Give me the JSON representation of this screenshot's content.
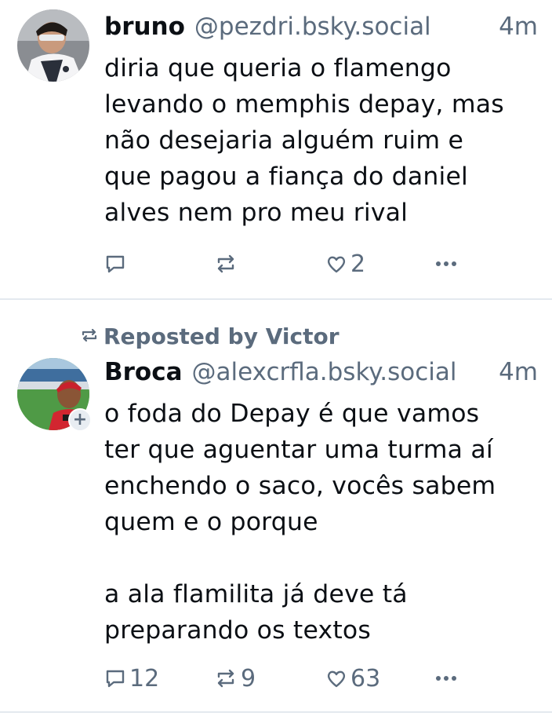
{
  "posts": [
    {
      "author": {
        "display_name": "bruno",
        "handle": "@pezdri.bsky.social"
      },
      "time": "4m",
      "text": "diria que queria o flamengo\nlevando o memphis depay, mas\nnão desejaria alguém ruim e\nque pagou a fiança do daniel\nalves nem pro meu rival",
      "actions": {
        "reply_count": "",
        "repost_count": "",
        "like_count": "2"
      }
    },
    {
      "repost_label": "Reposted by Victor",
      "author": {
        "display_name": "Broca",
        "handle": "@alexcrfla.bsky.social"
      },
      "time": "4m",
      "follow_badge": "+",
      "text": "o foda do Depay é que vamos\nter que aguentar uma turma aí\nenchendo o saco, vocês sabem\nquem e o porque\n\na ala flamilita já deve tá\npreparando os textos",
      "actions": {
        "reply_count": "12",
        "repost_count": "9",
        "like_count": "63"
      }
    }
  ],
  "icons": [
    "reply-icon",
    "repost-icon",
    "like-icon",
    "more-icon"
  ]
}
